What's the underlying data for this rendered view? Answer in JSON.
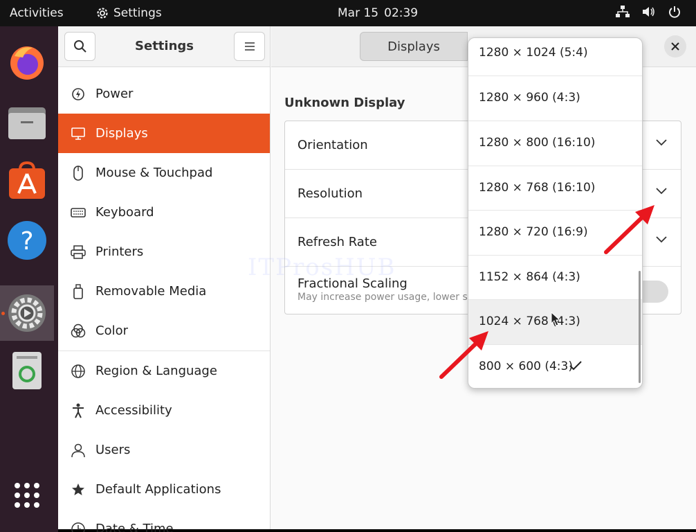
{
  "topbar": {
    "activities": "Activities",
    "app_name": "Settings",
    "date": "Mar 15",
    "time": "02:39"
  },
  "dock": {
    "apps": [
      "firefox-icon",
      "files-icon",
      "software-icon",
      "help-icon",
      "settings-icon",
      "trash-icon",
      "app-grid-icon"
    ]
  },
  "sidebar": {
    "title": "Settings",
    "items": [
      {
        "label": "Power",
        "icon": "power-icon"
      },
      {
        "label": "Displays",
        "icon": "display-icon"
      },
      {
        "label": "Mouse & Touchpad",
        "icon": "mouse-icon"
      },
      {
        "label": "Keyboard",
        "icon": "keyboard-icon"
      },
      {
        "label": "Printers",
        "icon": "printer-icon"
      },
      {
        "label": "Removable Media",
        "icon": "removable-media-icon"
      },
      {
        "label": "Color",
        "icon": "color-icon"
      },
      {
        "label": "Region & Language",
        "icon": "globe-icon"
      },
      {
        "label": "Accessibility",
        "icon": "accessibility-icon"
      },
      {
        "label": "Users",
        "icon": "users-icon"
      },
      {
        "label": "Default Applications",
        "icon": "star-icon"
      },
      {
        "label": "Date & Time",
        "icon": "clock-icon"
      }
    ]
  },
  "content": {
    "tab_label": "Displays",
    "section_title": "Unknown Display",
    "rows": {
      "orientation": "Orientation",
      "resolution": "Resolution",
      "refresh_rate": "Refresh Rate",
      "fractional_scaling": "Fractional Scaling",
      "fractional_scaling_sub": "May increase power usage, lower sp"
    }
  },
  "resolution_popover": {
    "options": [
      "1280 × 1024 (5:4)",
      "1280 × 960 (4:3)",
      "1280 × 800 (16:10)",
      "1280 × 768 (16:10)",
      "1280 × 720 (16:9)",
      "1152 × 864 (4:3)",
      "1024 × 768 (4:3)",
      "800 × 600 (4:3)"
    ],
    "selected": "800 × 600 (4:3)",
    "hovered": "1024 × 768 (4:3)"
  },
  "watermark": "ITProsHUB",
  "colors": {
    "accent": "#e95420",
    "dock_bg": "#2e1d29",
    "annotation_arrow": "#e8171f"
  }
}
